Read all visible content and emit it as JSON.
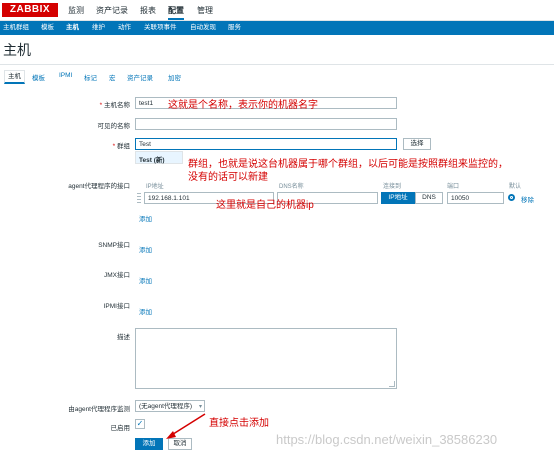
{
  "logo": "ZABBIX",
  "top_menu": [
    "监测",
    "资产记录",
    "报表",
    "配置",
    "管理"
  ],
  "sub_menu": [
    "主机群组",
    "模板",
    "主机",
    "维护",
    "动作",
    "关联项事件",
    "自动发现",
    "服务"
  ],
  "page_title": "主机",
  "tabs": [
    "主机",
    "模板",
    "IPMI",
    "标记",
    "宏",
    "资产记录",
    "加密"
  ],
  "form": {
    "hostname_label": "主机名称",
    "hostname_value": "test1",
    "visible_name_label": "可见的名称",
    "visible_name_value": "",
    "groups_label": "群组",
    "groups_value": "Test",
    "select_button": "选择",
    "dropdown_option": "Test (新)",
    "agent_interface_label": "agent代理程序的接口",
    "col_ip": "IP地址",
    "col_dns": "DNS名称",
    "col_connect": "连接到",
    "col_port": "端口",
    "col_default": "默认",
    "ip_value": "192.168.1.101",
    "dns_value": "",
    "ip_button": "IP地址",
    "dns_button": "DNS",
    "port_value": "10050",
    "remove_link": "移除",
    "add_link": "添加",
    "snmp_label": "SNMP接口",
    "jmx_label": "JMX接口",
    "ipmi_label": "IPMI接口",
    "description_label": "描述",
    "monitored_by_label": "由agent代理程序监测",
    "monitored_by_value": "(无agent代理程序)",
    "enabled_label": "已启用",
    "add_button": "添加",
    "cancel_button": "取消"
  },
  "annotations": {
    "hostname_note": "这就是个名称，表示你的机器名字",
    "group_note_1": "群组，也就是说这台机器属于哪个群组，以后可能是按照群组来监控的，",
    "group_note_2": "没有的话可以新建",
    "ip_note": "这里就是自己的机器ip",
    "add_note": "直接点击添加"
  },
  "watermark": "https://blog.csdn.net/weixin_38586230",
  "colors": {
    "brand": "#d40000",
    "nav": "#0275b8",
    "annotation": "#d40000"
  }
}
